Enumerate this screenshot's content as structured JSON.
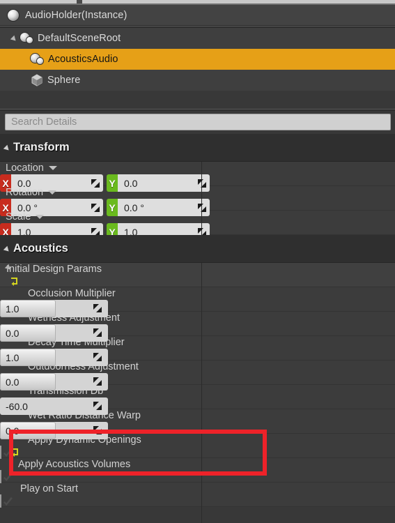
{
  "window": {
    "title": "AudioHolder(Instance)"
  },
  "colors": {
    "accent_selected": "#e6a017",
    "axis_x": "#c82c1e",
    "axis_y": "#6aba1e",
    "reset_arrow": "#d4d420",
    "annotation": "#ee2229",
    "panel_bg": "#383838"
  },
  "tree": {
    "root": {
      "label": "AudioHolder(Instance)",
      "icon": "actor-sphere-icon"
    },
    "items": [
      {
        "label": "DefaultSceneRoot",
        "icon": "scene-component-icon",
        "indent": 0,
        "expanded": true,
        "selected": false
      },
      {
        "label": "AcousticsAudio",
        "icon": "scene-component-icon",
        "indent": 1,
        "expanded": false,
        "selected": true
      },
      {
        "label": "Sphere",
        "icon": "static-mesh-icon",
        "indent": 1,
        "expanded": false,
        "selected": false
      }
    ]
  },
  "search": {
    "value": "",
    "placeholder": "Search Details",
    "icon": "search-icon"
  },
  "sections": [
    {
      "title": "Transform",
      "expanded": true,
      "rows": [
        {
          "type": "vector",
          "label": "Location",
          "indent": 0,
          "has_dropdown": true,
          "axes": [
            {
              "axis": "X",
              "value": "0.0"
            },
            {
              "axis": "Y",
              "value": "0.0"
            }
          ]
        },
        {
          "type": "vector",
          "label": "Rotation",
          "indent": 0,
          "has_dropdown": true,
          "axes": [
            {
              "axis": "X",
              "value": "0.0 °"
            },
            {
              "axis": "Y",
              "value": "0.0 °"
            }
          ]
        },
        {
          "type": "vector",
          "label": "Scale",
          "indent": 0,
          "has_dropdown": true,
          "axes": [
            {
              "axis": "X",
              "value": "1.0"
            },
            {
              "axis": "Y",
              "value": "1.0"
            }
          ]
        }
      ]
    },
    {
      "title": "Acoustics",
      "expanded": true,
      "rows": [
        {
          "type": "group",
          "label": "Initial Design Params",
          "indent": 0,
          "expanded": true,
          "reset": true
        },
        {
          "type": "slider",
          "label": "Occlusion Multiplier",
          "indent": 2,
          "value": "1.0",
          "filled": true
        },
        {
          "type": "slider",
          "label": "Wetness Adjustment",
          "indent": 2,
          "value": "0.0",
          "filled": true
        },
        {
          "type": "slider",
          "label": "Decay Time Multiplier",
          "indent": 2,
          "value": "1.0",
          "filled": true
        },
        {
          "type": "slider",
          "label": "Outdoorness Adjustment",
          "indent": 2,
          "value": "0.0",
          "filled": true
        },
        {
          "type": "slider",
          "label": "Transmission Db",
          "indent": 2,
          "value": "-60.0",
          "filled": false
        },
        {
          "type": "slider",
          "label": "Wet Ratio Distance Warp",
          "indent": 2,
          "value": "0.0",
          "filled": true
        },
        {
          "type": "check",
          "label": "Apply Dynamic Openings",
          "indent": 2,
          "checked": true,
          "reset": true
        },
        {
          "type": "check",
          "label": "Apply Acoustics Volumes",
          "indent": 1,
          "checked": true,
          "reset": false
        },
        {
          "type": "check",
          "label": "Play on Start",
          "indent": 3,
          "checked": true,
          "reset": false
        }
      ]
    }
  ],
  "annotation": {
    "shape": "rectangle",
    "color": "#ee2229",
    "targets": [
      "Wet Ratio Distance Warp",
      "Apply Dynamic Openings"
    ]
  }
}
